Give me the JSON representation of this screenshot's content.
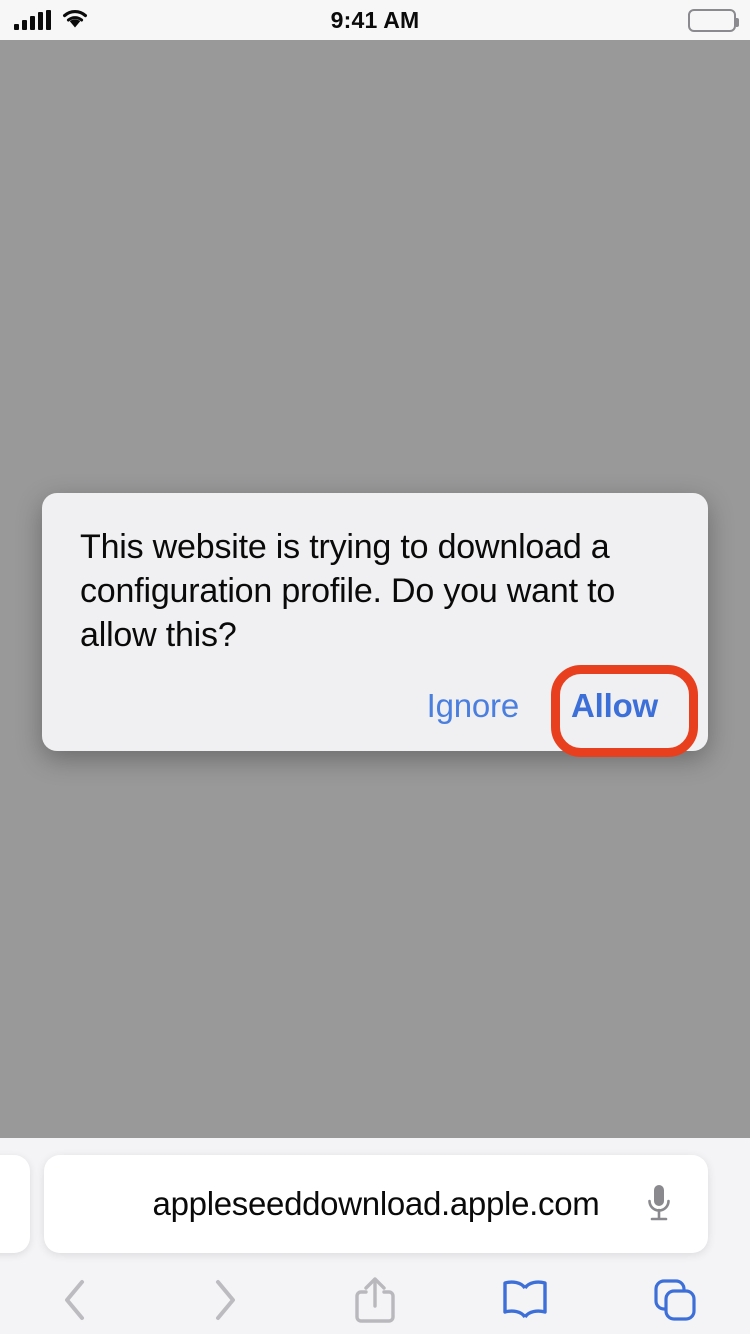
{
  "status_bar": {
    "time": "9:41 AM",
    "signal_icon": "cellular-signal-icon",
    "wifi_icon": "wifi-icon",
    "battery_icon": "battery-full-icon"
  },
  "alert": {
    "message": "This website is trying to download a configuration profile. Do you want to allow this?",
    "ignore_label": "Ignore",
    "allow_label": "Allow",
    "button_color": "#4a7fe0",
    "background": "#f0f0f2"
  },
  "annotation": {
    "target": "Allow",
    "shape": "rounded-rectangle-outline",
    "color": "#e8401e"
  },
  "browser": {
    "url": "appleseeddownload.apple.com",
    "mic_icon": "microphone-icon",
    "toolbar": {
      "back_icon": "chevron-left-icon",
      "forward_icon": "chevron-right-icon",
      "share_icon": "share-icon",
      "bookmarks_icon": "book-icon",
      "tabs_icon": "tabs-icon",
      "inactive_color": "#b9b9bd",
      "active_color": "#3d6fd9"
    }
  },
  "page": {
    "background_color": "#999999"
  }
}
